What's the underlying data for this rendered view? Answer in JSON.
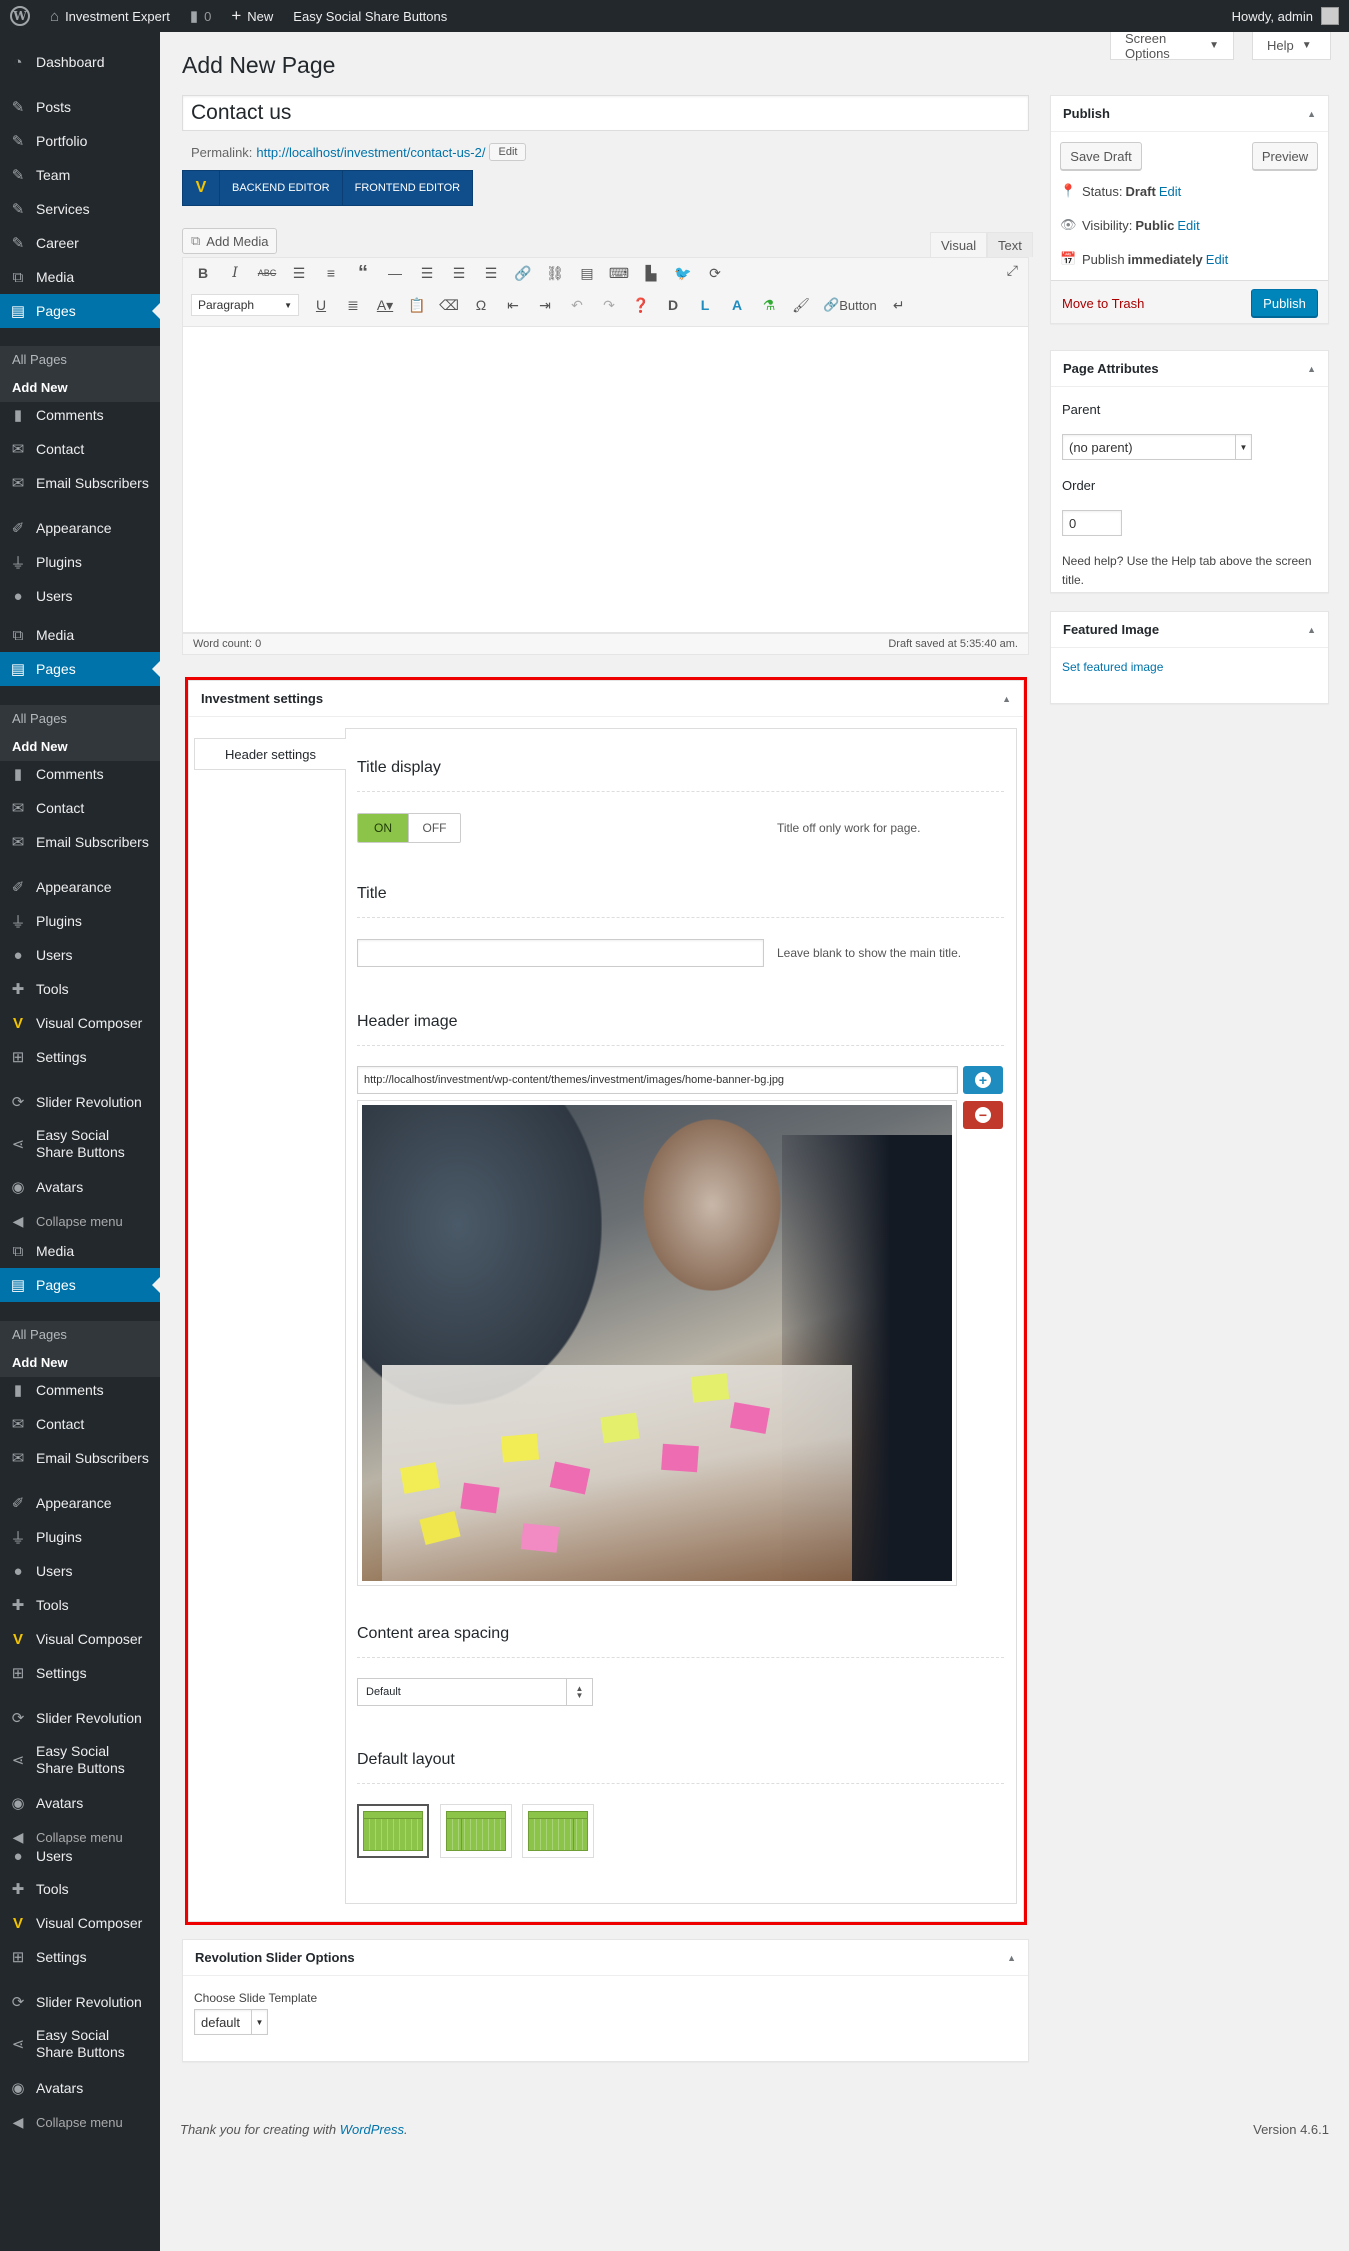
{
  "adminbar": {
    "site_name": "Investment Expert",
    "comments_count": "0",
    "new_label": "New",
    "plugin_label": "Easy Social Share Buttons",
    "howdy": "Howdy, admin"
  },
  "sidebar": {
    "items": [
      {
        "label": "Dashboard",
        "icon": "dashboard-icon"
      },
      {
        "label": "Posts",
        "icon": "pin-icon"
      },
      {
        "label": "Portfolio",
        "icon": "pin-icon"
      },
      {
        "label": "Team",
        "icon": "pin-icon"
      },
      {
        "label": "Services",
        "icon": "pin-icon"
      },
      {
        "label": "Career",
        "icon": "pin-icon"
      },
      {
        "label": "Media",
        "icon": "media-icon"
      },
      {
        "label": "Pages",
        "icon": "pages-icon"
      },
      {
        "label": "Comments",
        "icon": "comment-icon"
      },
      {
        "label": "Contact",
        "icon": "mail-icon"
      },
      {
        "label": "Email Subscribers",
        "icon": "mail-icon"
      },
      {
        "label": "Appearance",
        "icon": "brush-icon"
      },
      {
        "label": "Plugins",
        "icon": "plug-icon"
      },
      {
        "label": "Users",
        "icon": "user-icon"
      },
      {
        "label": "Tools",
        "icon": "wrench-icon"
      },
      {
        "label": "Visual Composer",
        "icon": "vc-icon"
      },
      {
        "label": "Settings",
        "icon": "settings-icon"
      },
      {
        "label": "Slider Revolution",
        "icon": "refresh-icon"
      },
      {
        "label": "Easy Social Share Buttons",
        "icon": "share-icon"
      },
      {
        "label": "Avatars",
        "icon": "avatar-icon"
      },
      {
        "label": "Collapse menu",
        "icon": "collapse-icon"
      }
    ],
    "sub_all_pages": "All Pages",
    "sub_add_new": "Add New"
  },
  "header": {
    "title": "Add New Page",
    "screen_options": "Screen Options",
    "help": "Help"
  },
  "editor": {
    "post_title": "Contact us",
    "permalink_label": "Permalink:",
    "permalink_url": "http://localhost/investment/contact-us-2/",
    "permalink_edit": "Edit",
    "backend_editor": "BACKEND EDITOR",
    "frontend_editor": "FRONTEND EDITOR",
    "add_media": "Add Media",
    "tab_visual": "Visual",
    "tab_text": "Text",
    "format_select": "Paragraph",
    "button_label": "Button",
    "word_count": "Word count: 0",
    "draft_saved": "Draft saved at 5:35:40 am."
  },
  "investment": {
    "box_title": "Investment settings",
    "tab_header": "Header settings",
    "title_display": "Title display",
    "toggle_on": "ON",
    "toggle_off": "OFF",
    "title_display_help": "Title off only work for page.",
    "title_heading": "Title",
    "title_value": "",
    "title_help": "Leave blank to show the main title.",
    "header_image": "Header image",
    "header_image_url": "http://localhost/investment/wp-content/themes/investment/images/home-banner-bg.jpg",
    "spacing_heading": "Content area spacing",
    "spacing_value": "Default",
    "layout_heading": "Default layout"
  },
  "revslider": {
    "box_title": "Revolution Slider Options",
    "choose_label": "Choose Slide Template",
    "template_value": "default"
  },
  "publish": {
    "title": "Publish",
    "save_draft": "Save Draft",
    "preview": "Preview",
    "status_label": "Status:",
    "status_value": "Draft",
    "visibility_label": "Visibility:",
    "visibility_value": "Public",
    "publish_label": "Publish",
    "publish_value": "immediately",
    "edit": "Edit",
    "trash": "Move to Trash",
    "publish_btn": "Publish"
  },
  "attributes": {
    "title": "Page Attributes",
    "parent_label": "Parent",
    "parent_value": "(no parent)",
    "order_label": "Order",
    "order_value": "0",
    "help_text": "Need help? Use the Help tab above the screen title."
  },
  "featured": {
    "title": "Featured Image",
    "link": "Set featured image"
  },
  "footer": {
    "thanks": "Thank you for creating with",
    "wp_link": "WordPress",
    "period": ".",
    "version": "Version 4.6.1"
  },
  "colors": {
    "accent": "#0073aa",
    "sidebar": "#23282d",
    "highlight_border": "#ee0000",
    "toggle_on": "#8cc44a"
  }
}
